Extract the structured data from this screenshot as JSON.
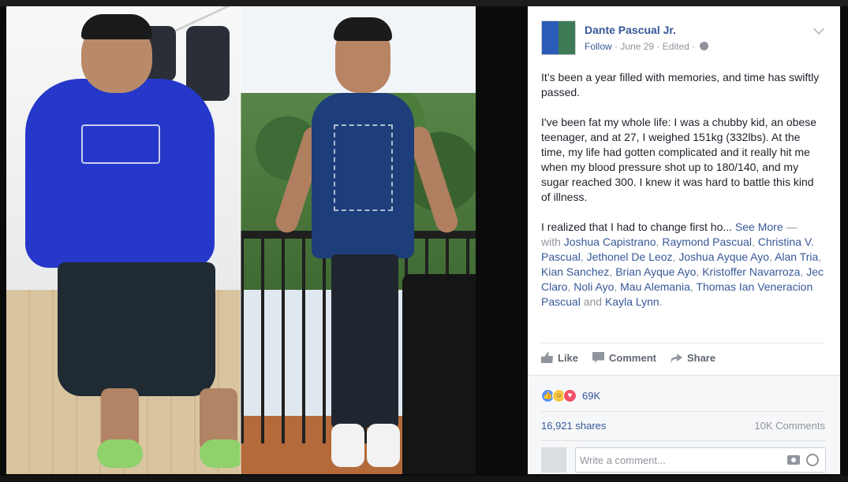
{
  "post": {
    "author": "Dante Pascual Jr.",
    "follow_label": "Follow",
    "separator": "·",
    "date": "June 29",
    "edited_label": "Edited",
    "paragraphs": [
      "It’s been a year filled with memories, and time has swiftly passed.",
      "I've been fat my whole life: I was a chubby kid, an obese teenager, and at 27, I weighed 151kg (332lbs). At the time, my life had gotten complicated and it really hit me when my blood pressure shot up to 180/140, and my sugar reached 300. I knew it was hard to battle this kind of illness."
    ],
    "truncated_text": "I realized that I had to change first ho...",
    "see_more_label": "See More",
    "dash": "—",
    "with_label": "with",
    "tagged": [
      "Joshua Capistrano",
      "Raymond Pascual",
      "Christina V. Pascual",
      "Jethonel De Leoz",
      "Joshua Ayque Ayo",
      "Alan Tria",
      "Kian Sanchez",
      "Brian Ayque Ayo",
      "Kristoffer Navarroza",
      "Jec Claro",
      "Noli Ayo",
      "Mau Alemania",
      "Thomas Ian Veneracion Pascual",
      "Kayla Lynn"
    ],
    "comma": ",",
    "and_label": "and",
    "period": "."
  },
  "actions": {
    "like_label": "Like",
    "comment_label": "Comment",
    "share_label": "Share"
  },
  "stats": {
    "reaction_count": "69K",
    "shares": "16,921 shares",
    "comments": "10K Comments"
  },
  "composer": {
    "placeholder": "Write a comment..."
  },
  "icons": {
    "like": "like-icon",
    "comment": "comment-icon",
    "share": "share-icon",
    "camera": "camera-icon",
    "emoji": "emoji-icon",
    "globe": "globe-icon",
    "chevron": "chevron-down-icon"
  },
  "colors": {
    "link": "#365899",
    "meta": "#90949c",
    "text": "#1d2129",
    "like_reaction": "#5890ff",
    "wow_reaction": "#f7c744",
    "love_reaction": "#f25268"
  }
}
